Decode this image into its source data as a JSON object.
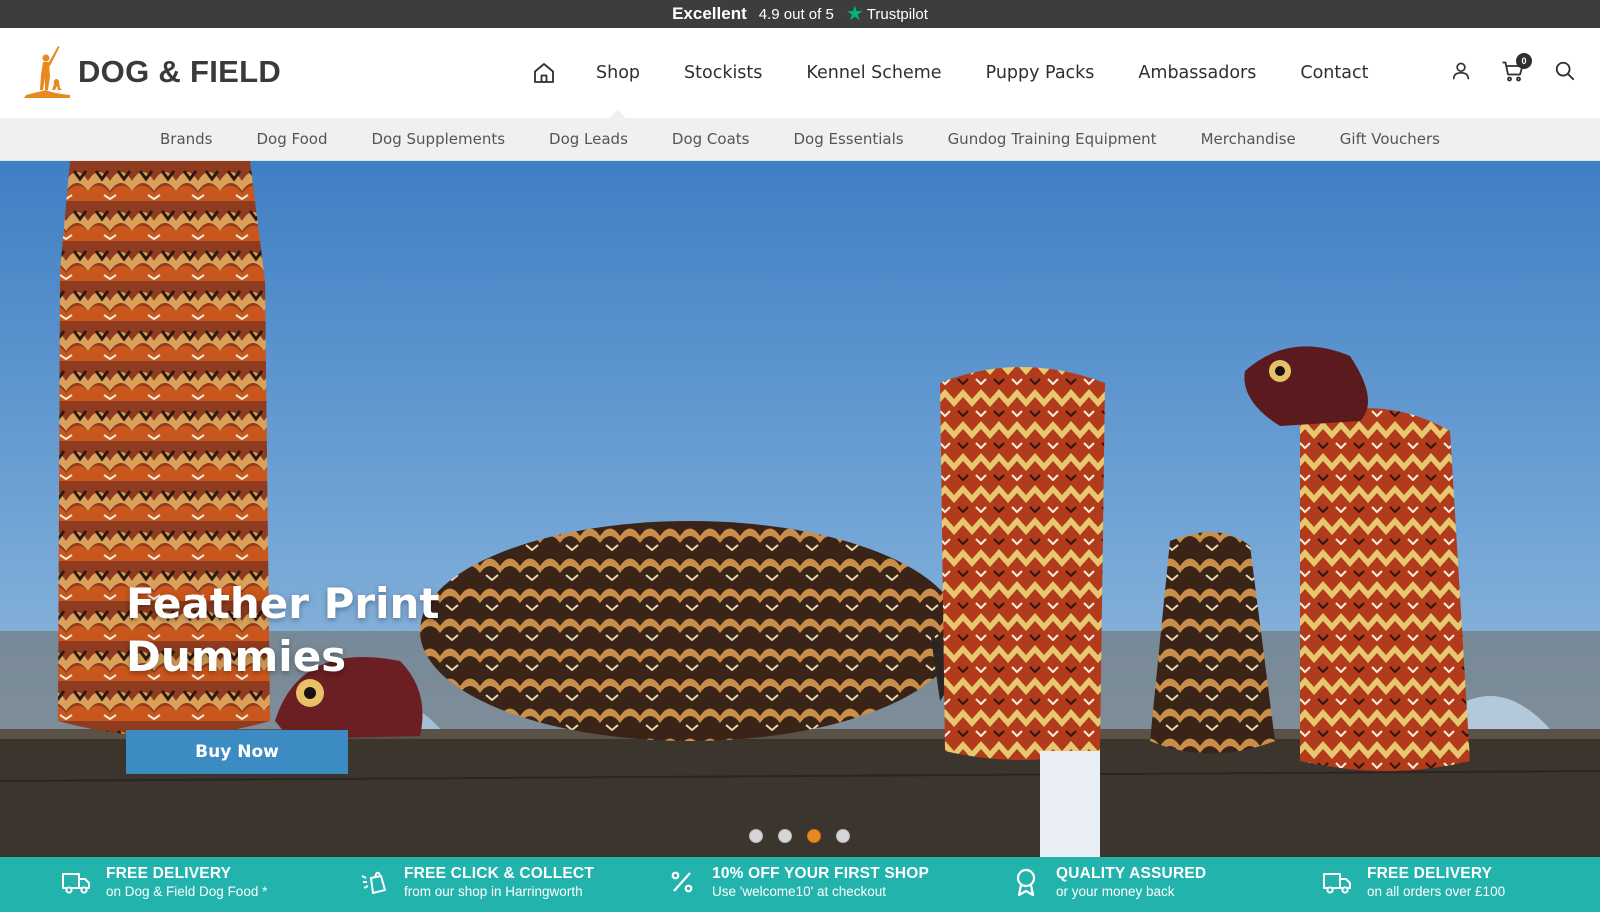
{
  "trustpilot": {
    "rating_word": "Excellent",
    "score": "4.9 out of 5",
    "brand": "Trustpilot"
  },
  "header": {
    "logo_text": "DOG & FIELD",
    "nav": [
      {
        "label": "Shop",
        "active": true
      },
      {
        "label": "Stockists"
      },
      {
        "label": "Kennel Scheme"
      },
      {
        "label": "Puppy Packs"
      },
      {
        "label": "Ambassadors"
      },
      {
        "label": "Contact"
      }
    ],
    "cart_count": "0",
    "icons": [
      "home-icon",
      "account-icon",
      "cart-icon",
      "search-icon"
    ]
  },
  "categories": [
    "Brands",
    "Dog Food",
    "Dog Supplements",
    "Dog Leads",
    "Dog Coats",
    "Dog Essentials",
    "Gundog Training Equipment",
    "Merchandise",
    "Gift Vouchers"
  ],
  "hero": {
    "title_line1": "Feather Print",
    "title_line2": "Dummies",
    "button_label": "Buy Now",
    "slide_count": 4,
    "active_slide": 3
  },
  "usps": [
    {
      "title": "FREE DELIVERY",
      "subtitle": "on Dog & Field Dog Food *",
      "icon": "truck-icon"
    },
    {
      "title": "FREE CLICK & COLLECT",
      "subtitle": "from our shop in Harringworth",
      "icon": "click-collect-icon"
    },
    {
      "title": "10% OFF YOUR FIRST SHOP",
      "subtitle": "Use 'welcome10' at checkout",
      "icon": "percent-icon"
    },
    {
      "title": "QUALITY ASSURED",
      "subtitle": "or your money back",
      "icon": "award-icon"
    },
    {
      "title": "FREE DELIVERY",
      "subtitle": "on all orders over £100",
      "icon": "truck-icon"
    }
  ],
  "colors": {
    "accent_orange": "#e8891f",
    "button_blue": "#3c8bc3",
    "usp_teal": "#23b3ad",
    "topbar_dark": "#3d3d3d",
    "trustpilot_green": "#00b67a"
  }
}
